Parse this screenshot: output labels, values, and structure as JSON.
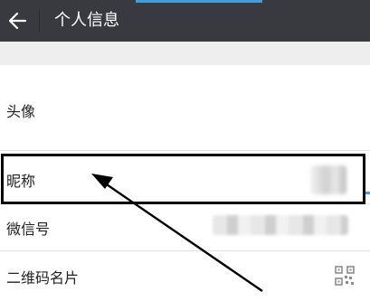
{
  "header": {
    "back_icon": "arrow-left-icon",
    "title": "个人信息"
  },
  "rows": [
    {
      "label": "头像"
    },
    {
      "label": "昵称"
    },
    {
      "label": "微信号"
    },
    {
      "label": "二维码名片",
      "icon": "qr-code-icon"
    }
  ],
  "colors": {
    "header_bg": "#393a3f",
    "annotation": "#000000"
  }
}
